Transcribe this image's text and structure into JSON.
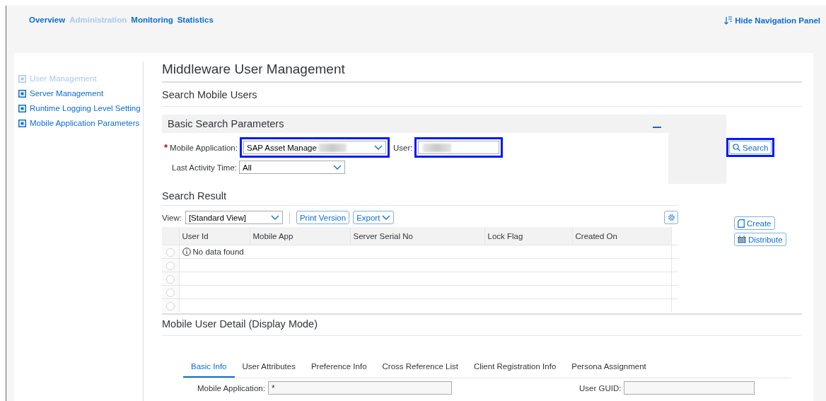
{
  "top_nav": {
    "links": [
      {
        "label": "Overview",
        "selected": false
      },
      {
        "label": "Administration",
        "selected": true
      },
      {
        "label": "Monitoring",
        "selected": false
      },
      {
        "label": "Statistics",
        "selected": false
      }
    ],
    "hide_panel": "Hide Navigation Panel"
  },
  "sidebar": {
    "items": [
      {
        "label": "User Management",
        "selected": true
      },
      {
        "label": "Server Management",
        "selected": false
      },
      {
        "label": "Runtime Logging Level Setting",
        "selected": false
      },
      {
        "label": "Mobile Application Parameters",
        "selected": false
      }
    ]
  },
  "page_title": "Middleware User Management",
  "section_title": "Search Mobile Users",
  "search_panel": {
    "title": "Basic Search Parameters",
    "mobile_application": {
      "label": "Mobile Application:",
      "required": true,
      "value": "SAP Asset Manage"
    },
    "user": {
      "label": "User:"
    },
    "last_activity": {
      "label": "Last Activity Time:",
      "value": "All"
    },
    "search_button": "Search"
  },
  "result": {
    "title": "Search Result",
    "view_label": "View:",
    "view_value": "[Standard View]",
    "print_button": "Print Version",
    "export_button": "Export",
    "table": {
      "columns": [
        "User Id",
        "Mobile App",
        "Server Serial No",
        "Lock Flag",
        "Created On"
      ],
      "empty_message": "No data found",
      "rows": [
        {
          "selected": false
        },
        {
          "selected": false
        },
        {
          "selected": false
        },
        {
          "selected": false
        },
        {
          "selected": false
        }
      ]
    },
    "create_button": "Create",
    "distribute_button": "Distribute"
  },
  "detail": {
    "title": "Mobile User Detail (Display Mode)",
    "tabs": [
      {
        "label": "Basic Info",
        "selected": true
      },
      {
        "label": "User Attributes",
        "selected": false
      },
      {
        "label": "Preference Info",
        "selected": false
      },
      {
        "label": "Cross Reference List",
        "selected": false
      },
      {
        "label": "Client Registration Info",
        "selected": false
      },
      {
        "label": "Persona Assignment",
        "selected": false
      }
    ],
    "fields": [
      {
        "label": "Mobile Application:",
        "value": "*"
      },
      {
        "label": "User GUID:"
      }
    ]
  }
}
